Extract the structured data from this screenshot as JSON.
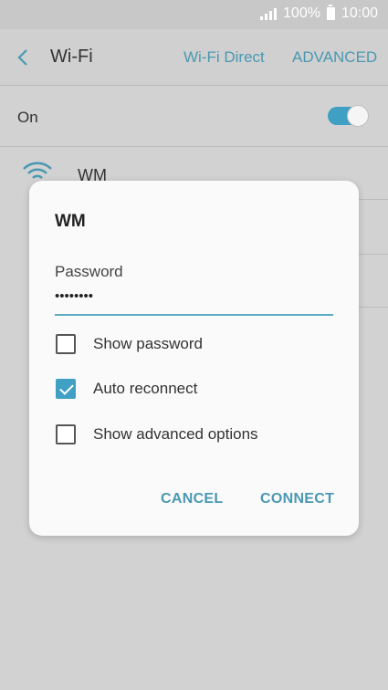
{
  "status_bar": {
    "battery_percent": "100%",
    "time": "10:00"
  },
  "header": {
    "title": "Wi-Fi",
    "wifi_direct": "Wi-Fi Direct",
    "advanced": "ADVANCED"
  },
  "toggle": {
    "label": "On",
    "state": "on"
  },
  "networks": [
    {
      "name": "WM"
    }
  ],
  "dialog": {
    "title": "WM",
    "password_label": "Password",
    "password_value": "••••••••",
    "options": [
      {
        "label": "Show password",
        "checked": false
      },
      {
        "label": "Auto reconnect",
        "checked": true
      },
      {
        "label": "Show advanced options",
        "checked": false
      }
    ],
    "cancel": "CANCEL",
    "connect": "CONNECT"
  },
  "colors": {
    "accent": "#3fa0c3",
    "link": "#4a98b3"
  }
}
